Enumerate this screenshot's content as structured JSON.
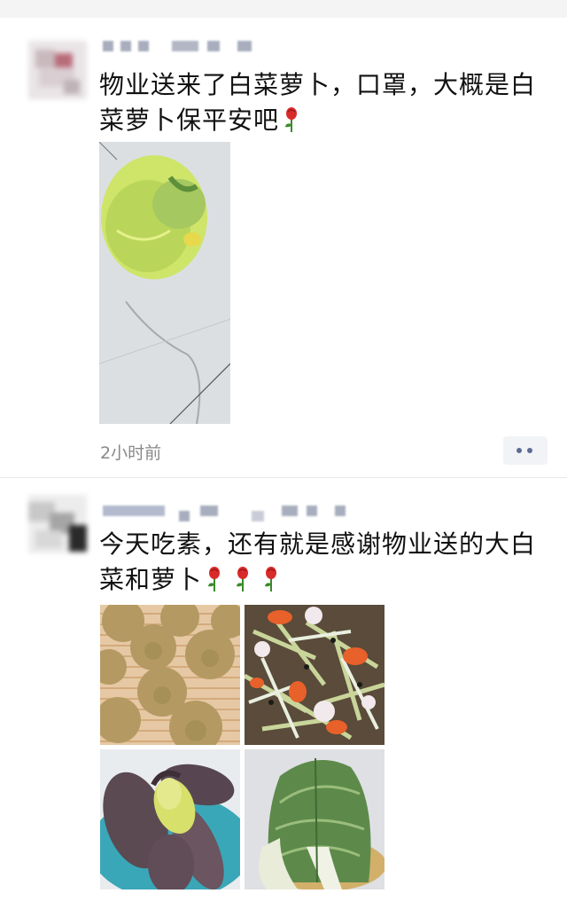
{
  "posts": [
    {
      "text": "物业送来了白菜萝卜，口罩，大概是白菜萝卜保平安吧",
      "emoji": [
        "rose-icon"
      ],
      "time": "2小时前"
    },
    {
      "text": "今天吃素，还有就是感谢物业送的大白菜和萝卜",
      "emoji": [
        "rose-icon",
        "rose-icon",
        "rose-icon"
      ]
    }
  ],
  "colors": {
    "link_blue": "#5b6b93",
    "time_gray": "#888888",
    "divider": "#e8e8e8"
  }
}
